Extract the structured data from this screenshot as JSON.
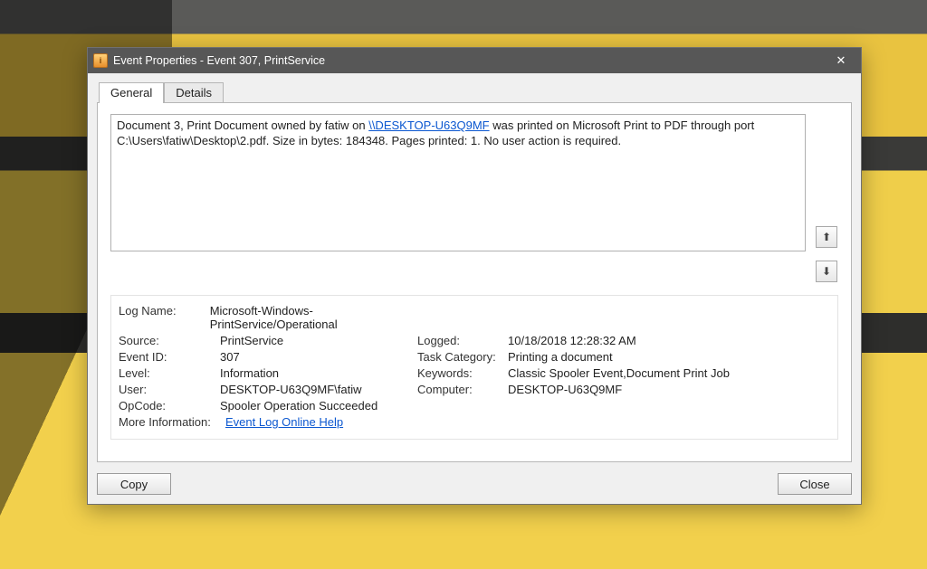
{
  "window": {
    "title": "Event Properties - Event 307, PrintService",
    "close_glyph": "✕"
  },
  "tabs": {
    "general": "General",
    "details": "Details"
  },
  "description": {
    "pre": "Document 3, Print Document owned by fatiw on ",
    "link": "\\\\DESKTOP-U63Q9MF",
    "post": " was printed on Microsoft Print to PDF through port C:\\Users\\fatiw\\Desktop\\2.pdf.  Size in bytes: 184348. Pages printed: 1. No user action is required."
  },
  "nav": {
    "up": "⬆",
    "down": "⬇"
  },
  "labels": {
    "log_name": "Log Name:",
    "source": "Source:",
    "event_id": "Event ID:",
    "level": "Level:",
    "user": "User:",
    "opcode": "OpCode:",
    "more_info": "More Information:",
    "logged": "Logged:",
    "task_category": "Task Category:",
    "keywords": "Keywords:",
    "computer": "Computer:"
  },
  "values": {
    "log_name": "Microsoft-Windows-PrintService/Operational",
    "source": "PrintService",
    "event_id": "307",
    "level": "Information",
    "user": "DESKTOP-U63Q9MF\\fatiw",
    "opcode": "Spooler Operation Succeeded",
    "more_info": "Event Log Online Help",
    "logged": "10/18/2018 12:28:32 AM",
    "task_category": "Printing a document",
    "keywords": "Classic Spooler Event,Document Print Job",
    "computer": "DESKTOP-U63Q9MF"
  },
  "buttons": {
    "copy": "Copy",
    "close": "Close"
  }
}
